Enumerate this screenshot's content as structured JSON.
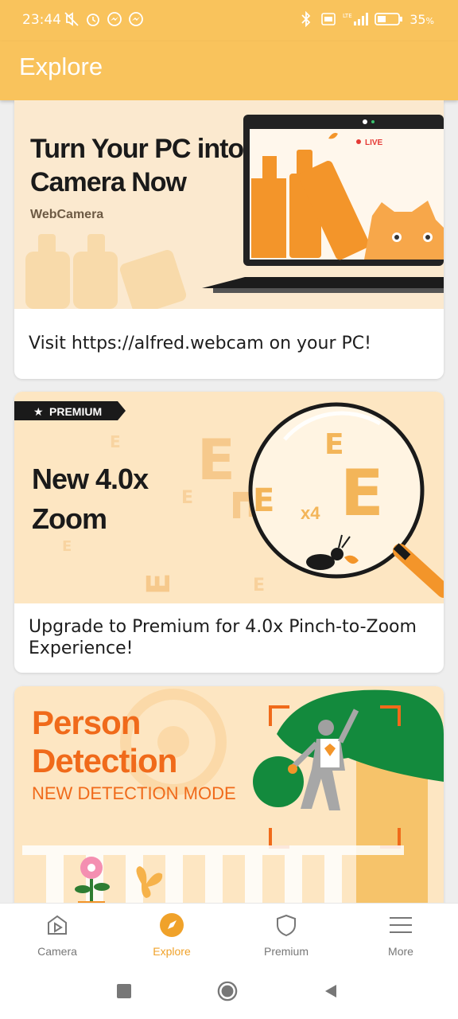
{
  "status_bar": {
    "time": "23:44",
    "battery": "35",
    "network": "LTE"
  },
  "app_bar": {
    "title": "Explore"
  },
  "cards": [
    {
      "banner_title_line1": "Turn Your PC into",
      "banner_title_line2": "Camera Now",
      "banner_brand": "WebCamera",
      "banner_live": "LIVE",
      "text": "Visit https://alfred.webcam on your PC!"
    },
    {
      "badge": "PREMIUM",
      "banner_title_line1": "New 4.0x",
      "banner_title_line2": "Zoom",
      "zoom_label": "x4",
      "text": "Upgrade to Premium for 4.0x Pinch-to-Zoom Experience!"
    },
    {
      "banner_title_line1": "Person",
      "banner_title_line2": "Detection",
      "banner_subtitle": "NEW DETECTION MODE"
    }
  ],
  "bottom_nav": [
    {
      "label": "Camera",
      "icon": "camera-play-icon"
    },
    {
      "label": "Explore",
      "icon": "compass-icon",
      "active": true
    },
    {
      "label": "Premium",
      "icon": "shield-icon"
    },
    {
      "label": "More",
      "icon": "menu-icon"
    }
  ],
  "colors": {
    "primary": "#f9c35c",
    "accent": "#f0a22a",
    "orange": "#f3952a"
  }
}
